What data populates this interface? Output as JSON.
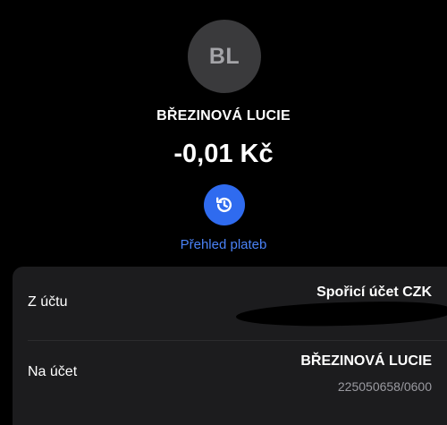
{
  "contact": {
    "initials": "BL",
    "name": "BŘEZINOVÁ LUCIE"
  },
  "transaction": {
    "amount": "-0,01 Kč"
  },
  "history": {
    "icon": "history-icon",
    "label": "Přehled plateb"
  },
  "details": {
    "from": {
      "label": "Z účtu",
      "value": "Spořicí účet CZK"
    },
    "to": {
      "label": "Na účet",
      "name": "BŘEZINOVÁ LUCIE",
      "account": "225050658/0600"
    }
  },
  "colors": {
    "background": "#000000",
    "accent": "#2f6bef",
    "link": "#4a82f7",
    "card": "#1c1c1e",
    "avatar": "#3a3a3c"
  }
}
